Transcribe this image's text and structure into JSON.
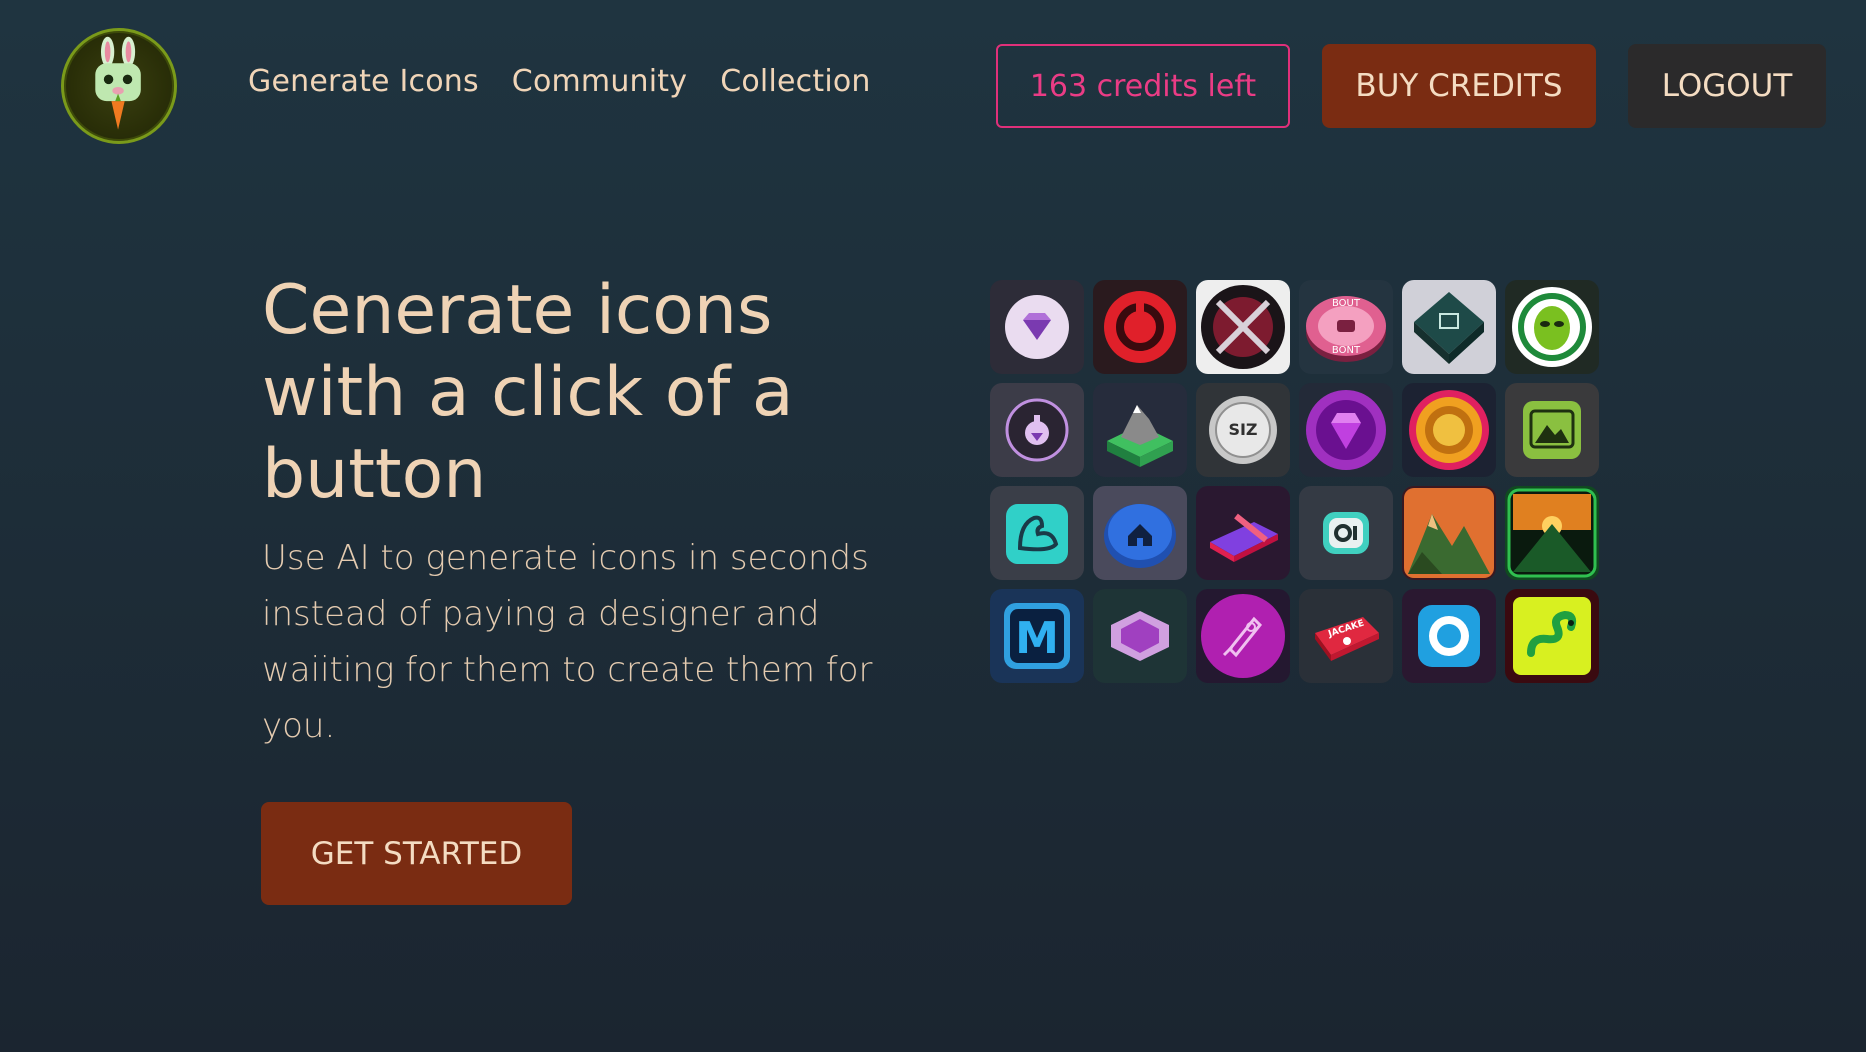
{
  "nav": {
    "items": [
      "Generate Icons",
      "Community",
      "Collection"
    ]
  },
  "header": {
    "credits_label": "163 credits left",
    "buy_label": "BUY CREDITS",
    "logout_label": "LOGOUT"
  },
  "hero": {
    "title": "Cenerate icons with a click of a button",
    "subtitle": "Use AI to generate icons in seconds instead of paying a designer and waiiting for them to create them for you.",
    "cta_label": "GET STARTED"
  },
  "icons": [
    "gem-icon",
    "power-ring-icon",
    "crossed-swords-icon",
    "badge-icon",
    "chip-icon",
    "alien-icon",
    "potion-icon",
    "mountain-block-icon",
    "coin-siz-icon",
    "purple-gem-icon",
    "gold-coin-icon",
    "landscape-icon",
    "muscle-arm-icon",
    "home-icon",
    "pencil-block-icon",
    "camera-icon",
    "mountain-sunset-icon",
    "volcano-icon",
    "letter-m-icon",
    "hexagon-gem-icon",
    "rocket-icon",
    "jacake-badge-icon",
    "camera-lens-icon",
    "snake-icon"
  ],
  "icon_text": {
    "coin": "SIZ",
    "badge_top": "BOUT",
    "badge_bottom": "BONT",
    "jacake": "JACAKE",
    "letter_m": "M"
  },
  "colors": {
    "accent_pink": "#e0307a",
    "brand_brown": "#7a2c12",
    "text_cream": "#f0d5b8"
  }
}
